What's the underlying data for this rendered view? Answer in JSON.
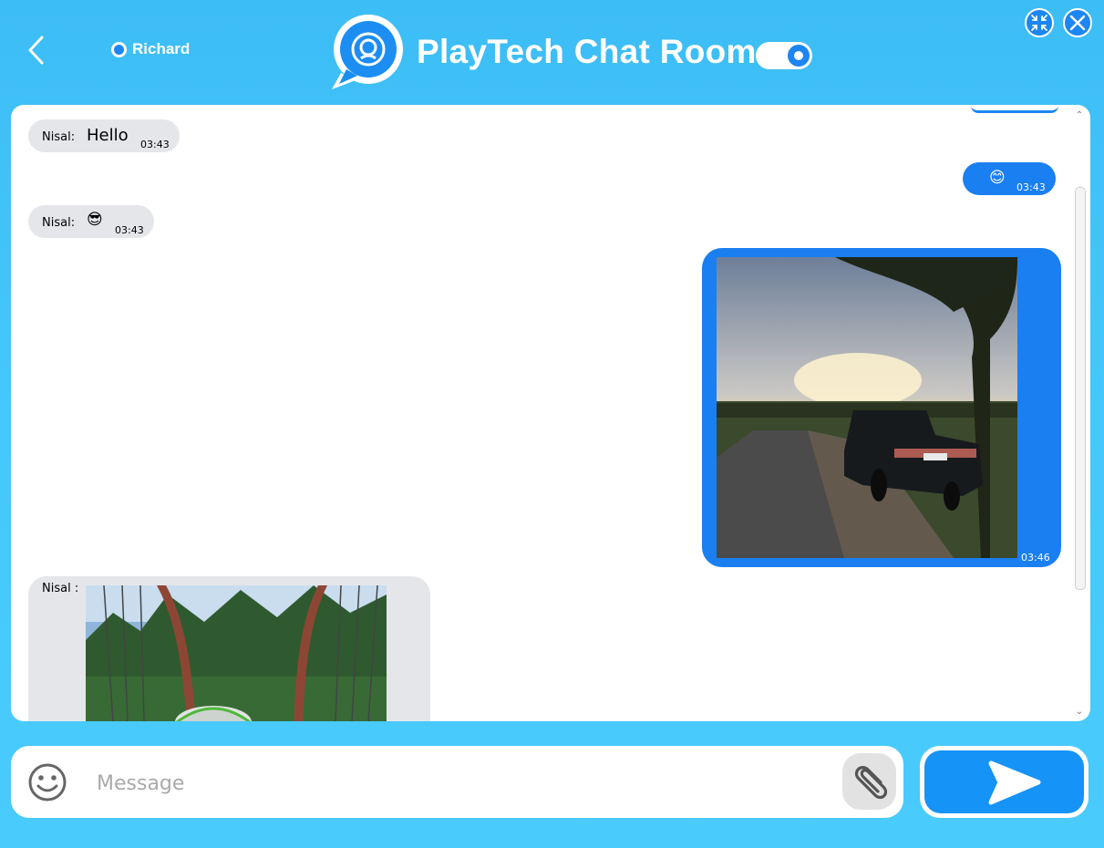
{
  "header": {
    "username": "Richard",
    "title": "PlayTech Chat Room"
  },
  "messages": [
    {
      "sender": "Nisal:",
      "text": "Hello",
      "time": "03:43",
      "direction": "incoming"
    },
    {
      "text": "😊",
      "time": "03:43",
      "direction": "outgoing"
    },
    {
      "sender": "Nisal:",
      "text": "😎",
      "time": "03:43",
      "direction": "incoming"
    },
    {
      "image": "car-on-road-photo",
      "time": "03:46",
      "direction": "outgoing"
    },
    {
      "sender": "Nisal :",
      "image": "car-on-bridge-photo",
      "direction": "incoming"
    }
  ],
  "composer": {
    "placeholder": "Message"
  },
  "colors": {
    "background": "#45c8fb",
    "accent": "#1a7ff0",
    "incoming_bubble": "#e5e6ea"
  }
}
